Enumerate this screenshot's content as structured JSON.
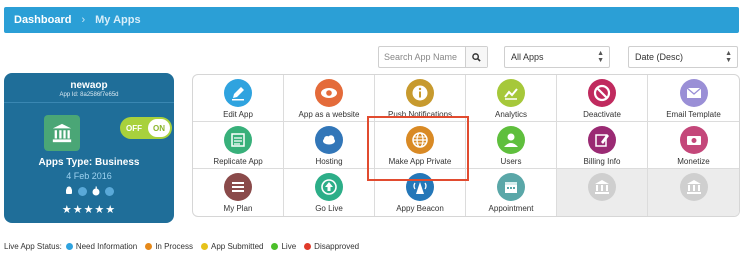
{
  "breadcrumb": {
    "home": "Dashboard",
    "current": "My Apps"
  },
  "toolbar": {
    "search_placeholder": "Search App Name",
    "filter_selected": "All Apps",
    "sort_selected": "Date (Desc)"
  },
  "app_card": {
    "name": "newaop",
    "app_id": "App Id: 8a2586f7e65d",
    "toggle_off": "OFF",
    "toggle_on": "ON",
    "apps_type": "Apps Type: Business",
    "date": "4 Feb 2016",
    "stars": "★★★★★",
    "background": "#1f6e99"
  },
  "tiles": [
    {
      "label": "Edit App",
      "icon": "pencil-icon",
      "color": "#2fa3df"
    },
    {
      "label": "App as a website",
      "icon": "eye-icon",
      "color": "#e46b3a"
    },
    {
      "label": "Push Notifications",
      "icon": "info-icon",
      "color": "#c79a2e"
    },
    {
      "label": "Analytics",
      "icon": "chart-icon",
      "color": "#a6c83a"
    },
    {
      "label": "Deactivate",
      "icon": "ban-icon",
      "color": "#c02a5e"
    },
    {
      "label": "Email Template",
      "icon": "envelope-icon",
      "color": "#9a8fd6"
    },
    {
      "label": "Replicate App",
      "icon": "copy-icon",
      "color": "#38b07a"
    },
    {
      "label": "Hosting",
      "icon": "cloud-icon",
      "color": "#3276b8"
    },
    {
      "label": "Make App Private",
      "icon": "globe-icon",
      "color": "#d98a25"
    },
    {
      "label": "Users",
      "icon": "user-icon",
      "color": "#5fbf3d"
    },
    {
      "label": "Billing Info",
      "icon": "edit-icon",
      "color": "#9a2a73"
    },
    {
      "label": "Monetize",
      "icon": "money-icon",
      "color": "#c4477a"
    },
    {
      "label": "My Plan",
      "icon": "list-icon",
      "color": "#8a4a4a"
    },
    {
      "label": "Go Live",
      "icon": "upload-icon",
      "color": "#2cae88"
    },
    {
      "label": "Appy Beacon",
      "icon": "beacon-icon",
      "color": "#2477b8"
    },
    {
      "label": "Appointment",
      "icon": "calendar-icon",
      "color": "#5aa7a8"
    },
    {
      "label": "",
      "icon": "bank-icon",
      "color": "#cfcfcf"
    },
    {
      "label": "",
      "icon": "bank-icon",
      "color": "#cfcfcf"
    }
  ],
  "legend": {
    "title": "Live App Status:",
    "items": [
      {
        "label": "Need Information",
        "color": "#2fa3df"
      },
      {
        "label": "In Process",
        "color": "#e6891a"
      },
      {
        "label": "App Submitted",
        "color": "#e6c21a"
      },
      {
        "label": "Live",
        "color": "#4cbf2a"
      },
      {
        "label": "Disapproved",
        "color": "#e03a2a"
      }
    ]
  }
}
